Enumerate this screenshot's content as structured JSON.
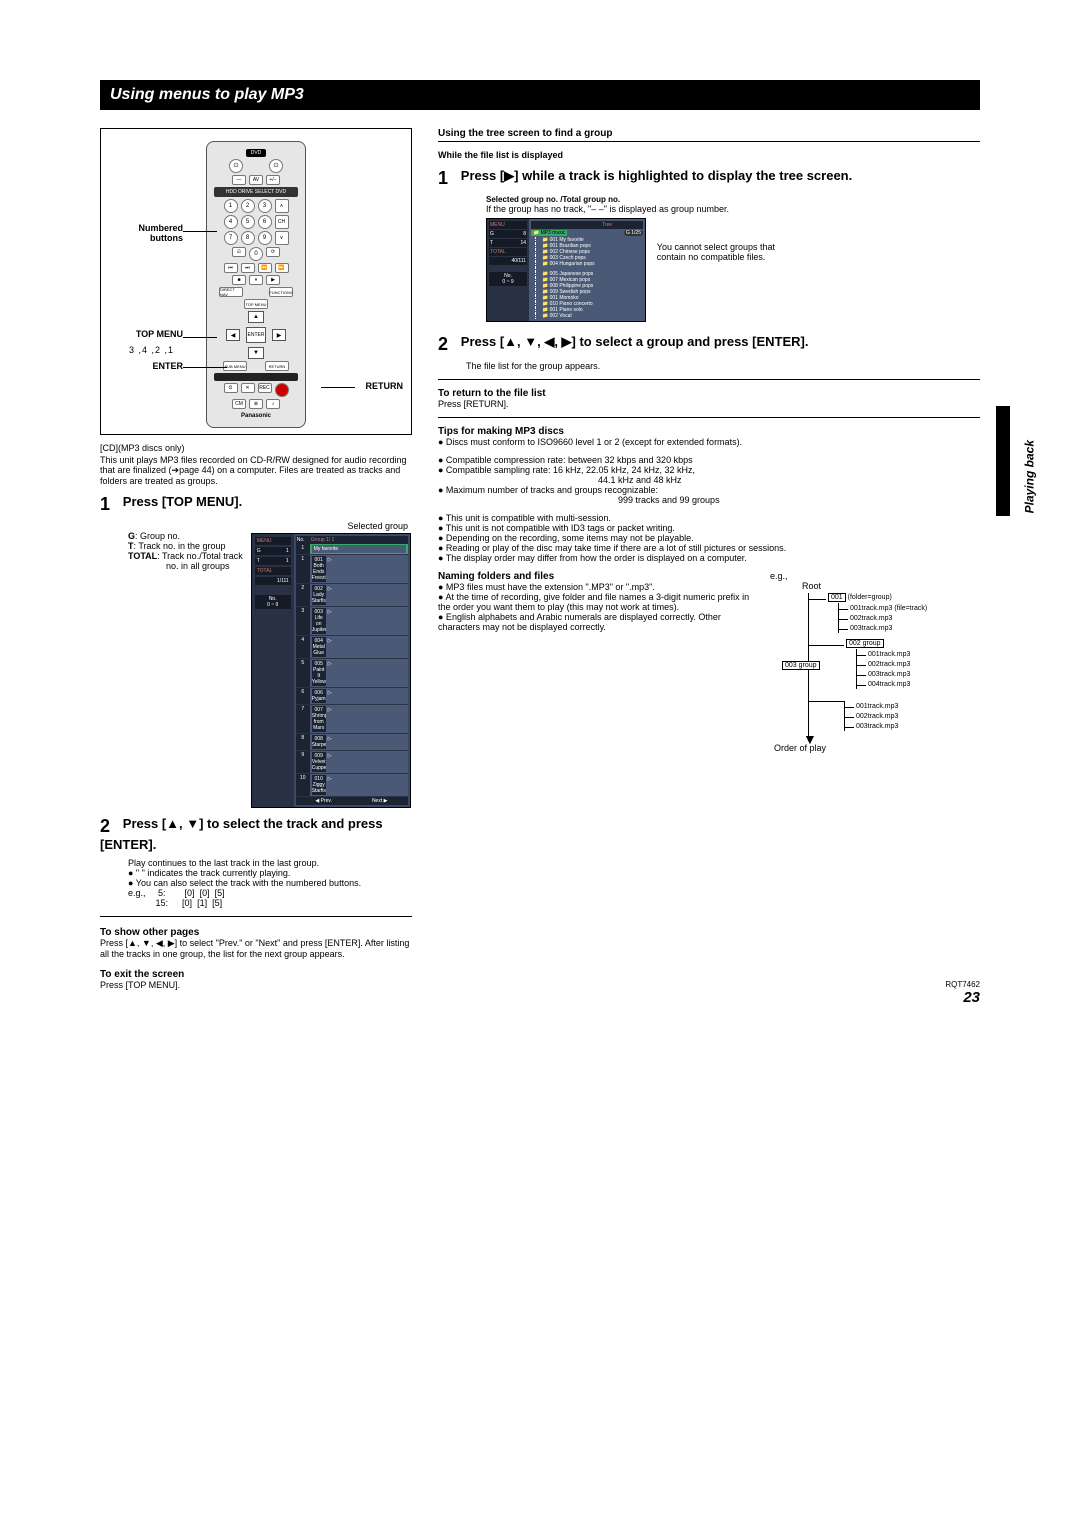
{
  "header": {
    "title": "Using menus to play MP3"
  },
  "remote": {
    "labels": {
      "numbered": "Numbered buttons",
      "topmenu": "TOP MENU",
      "enter": "ENTER",
      "return": "RETURN",
      "sequence": "3 ,4 ,2 ,1"
    },
    "bar_hdd": "HDD  DRIVE SELECT  DVD",
    "brand": "Panasonic",
    "nums": [
      "1",
      "2",
      "3",
      "4",
      "5",
      "6",
      "7",
      "8",
      "9",
      "0"
    ]
  },
  "intro": {
    "disc_note": "[CD](MP3 discs only)",
    "body": "This unit plays MP3 files recorded on CD-R/RW designed for audio recording that are finalized (➔page 44) on a computer. Files are treated as tracks and folders are treated as groups."
  },
  "step1": {
    "num": "1",
    "title": "Press [TOP MENU].",
    "selected_group": "Selected group",
    "legend": {
      "g": "G",
      "g_desc": ": Group no.",
      "t": "T",
      "t_desc": ": Track no. in the group",
      "total": "TOTAL",
      "total_desc": ": Track no./Total track",
      "total_desc2": "no. in all groups"
    }
  },
  "menuShot1": {
    "side": {
      "menu": "MENU",
      "g": "G",
      "gval": "1",
      "t": "T",
      "tval": "1",
      "total": "TOTAL",
      "totalval": "1/111",
      "no": "No.",
      "numpad": "0 ~ 9"
    },
    "head_no": "No.",
    "head_grp": "Group     1/       1",
    "sel_title": "My favorite",
    "rows": [
      {
        "n": "1",
        "t": "001 Both Ends Freezing"
      },
      {
        "n": "2",
        "t": "002 Lady Starfish"
      },
      {
        "n": "3",
        "t": "003 Life on Jupiter"
      },
      {
        "n": "4",
        "t": "004 Metal Glue"
      },
      {
        "n": "5",
        "t": "005 Paint It Yellow"
      },
      {
        "n": "6",
        "t": "006 Pyjamamama"
      },
      {
        "n": "7",
        "t": "007 Shrimps from Mars"
      },
      {
        "n": "8",
        "t": "008 Starperson"
      },
      {
        "n": "9",
        "t": "009 Velvet Cuppermine"
      },
      {
        "n": "10",
        "t": "010 Ziggy Starfish"
      }
    ],
    "pager_prev": "◀ Prev.",
    "pager_next": "Next ▶"
  },
  "step2L": {
    "num": "2",
    "title": "Press [▲, ▼] to select the track and press [ENTER].",
    "cont": "Play continues to the last track in the last group.",
    "curr": "● \"   \" indicates the track currently playing.",
    "numbtn": "● You can also select the track with the numbered buttons.",
    "eg_label": "e.g.,",
    "eg1_a": "5:",
    "eg1": [
      "[0]",
      "[0]",
      "[5]"
    ],
    "eg2_a": "15:",
    "eg2": [
      "[0]",
      "[1]",
      "[5]"
    ]
  },
  "other_pages": {
    "h": "To show other pages",
    "body": "Press [▲, ▼, ◀, ▶] to select \"Prev.\" or \"Next\" and press [ENTER]. After listing all the tracks in one group, the list for the next group appears."
  },
  "exit": {
    "h": "To exit the screen",
    "body": "Press [TOP MENU]."
  },
  "right": {
    "tree_head": "Using the tree screen to find a group",
    "while": "While the file list is displayed",
    "step1_num": "1",
    "step1_title": "Press [▶] while a track is highlighted to display the tree screen.",
    "selgrp": "Selected group no. /Total group no.",
    "selgrp_note": "If the group has no track, \"– –\" is displayed as group number.",
    "aside": "You cannot select groups that contain no compatible files."
  },
  "treeShot": {
    "side": {
      "menu": "MENU",
      "g": "G",
      "gval": "8",
      "t": "T",
      "tval": "14",
      "total": "TOTAL",
      "totalval": "40/111",
      "no": "No.",
      "numpad": "0 ~ 9"
    },
    "head_l": "",
    "head_r": "Tree",
    "gno": "G   1/25",
    "sel": "MP3 music",
    "items": [
      "001 My favorite",
      "001 Brazilian pops",
      "002 Chinese pops",
      "003 Czech pops",
      "004 Hungarian pops",
      "",
      "005 Japanese pops",
      "007 Mexican pops",
      "008 Philippine pops",
      "009 Swedish pops",
      "001 Momoko",
      "010 Piano concerto",
      "001 Piano solo",
      "002 Vocal"
    ],
    "grey_idx": [
      5
    ]
  },
  "step2R": {
    "num": "2",
    "title": "Press [▲, ▼, ◀, ▶] to select a group and press [ENTER].",
    "body": "The file list for the group appears."
  },
  "return_list": {
    "h": "To return to the file list",
    "body": "Press [RETURN]."
  },
  "tips": {
    "h": "Tips for making MP3 discs",
    "b1": "● Discs must conform to ISO9660 level 1 or 2 (except for extended formats).",
    "b2": "● Compatible compression rate: between 32 kbps and 320 kbps",
    "b3": "● Compatible sampling rate: 16 kHz, 22.05 kHz, 24 kHz, 32 kHz,",
    "b3b": "44.1 kHz and 48 kHz",
    "b4": "● Maximum number of tracks and groups recognizable:",
    "b4b": "999 tracks and 99 groups",
    "b5": "● This unit is compatible with multi-session.",
    "b6": "● This unit is not compatible with ID3 tags or packet writing.",
    "b7": "● Depending on the recording, some items may not be playable.",
    "b8": "● Reading or play of the disc may take time if there are a lot of still pictures or sessions.",
    "b9": "● The display order may differ from how the order is displayed on a computer."
  },
  "naming": {
    "h": "Naming folders and files",
    "eg": "e.g.,",
    "root": "Root",
    "l1": "● MP3 files must have the extension \".MP3\" or \".mp3\".",
    "l2": "● At the time of recording, give folder and file names a 3-digit numeric prefix in the order you want them to play (this may not work at times).",
    "l3": "● English alphabets and Arabic numerals are displayed correctly. Other characters may not be displayed correctly.",
    "order": "Order of play",
    "ftree": {
      "g001": "001",
      "g001_note": "(folder=group)",
      "f001a": "001track.mp3",
      "f001a_note": "(file=track)",
      "f002a": "002track.mp3",
      "f003a": "003track.mp3",
      "g002": "002 group",
      "f001b": "001track.mp3",
      "f002b": "002track.mp3",
      "f003b": "003track.mp3",
      "f004b": "004track.mp3",
      "g003": "003 group",
      "f001c": "001track.mp3",
      "f002c": "002track.mp3",
      "f003c": "003track.mp3"
    }
  },
  "sidetab": "Playing back",
  "footer": {
    "code": "RQT7462",
    "page": "23"
  }
}
